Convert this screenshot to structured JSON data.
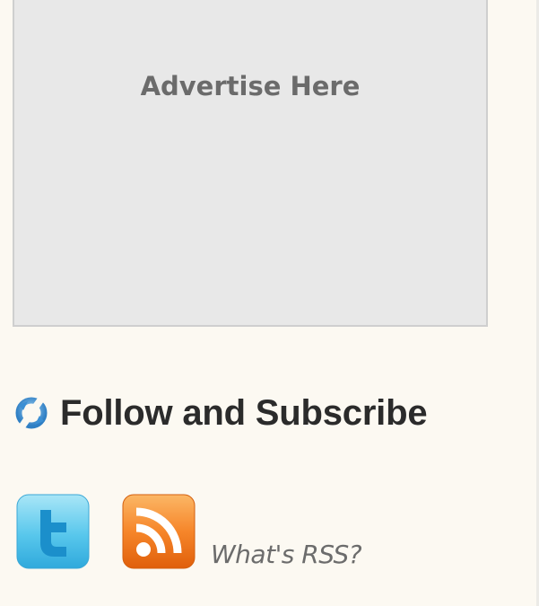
{
  "advertisement": {
    "label": "Advertise Here"
  },
  "follow_section": {
    "title": "Follow and Subscribe",
    "icon": "refresh-icon"
  },
  "social": {
    "twitter": {
      "icon": "twitter-icon"
    },
    "rss": {
      "icon": "rss-icon"
    },
    "whats_rss_link": "What's RSS?"
  },
  "colors": {
    "page_background": "#fcf9f2",
    "ad_background": "#e8e8e8",
    "ad_border": "#cfcfcf",
    "ad_text": "#6b6b6b",
    "heading_text": "#2b2b2b",
    "twitter_blue": "#4fc2e8",
    "rss_orange": "#f57e1f",
    "link_text": "#6c6c6c"
  }
}
